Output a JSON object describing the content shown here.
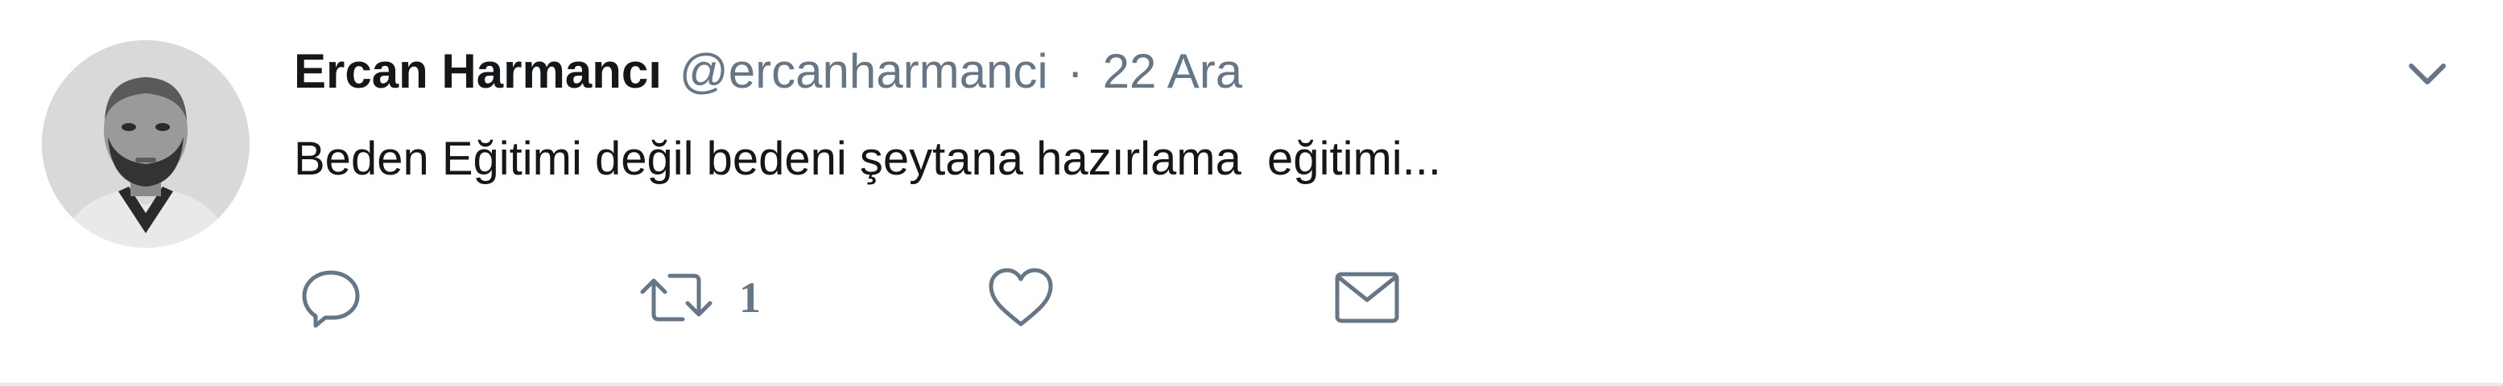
{
  "tweet": {
    "author": {
      "fullname": "Ercan Harmancı",
      "username": "@ercanharmanci",
      "avatar_icon": "user-photo"
    },
    "separator": "·",
    "timestamp": "22 Ara",
    "text": "Beden Eğitimi değil bedeni şeytana hazırlama  eğitimi...",
    "actions": {
      "reply": {
        "icon": "reply-icon",
        "count": ""
      },
      "retweet": {
        "icon": "retweet-icon",
        "count": "1"
      },
      "like": {
        "icon": "heart-icon",
        "count": ""
      },
      "dm": {
        "icon": "envelope-icon"
      }
    },
    "menu_icon": "chevron-down-icon"
  },
  "colors": {
    "name": "#14171a",
    "secondary": "#657786",
    "divider": "#e6ecf0"
  }
}
